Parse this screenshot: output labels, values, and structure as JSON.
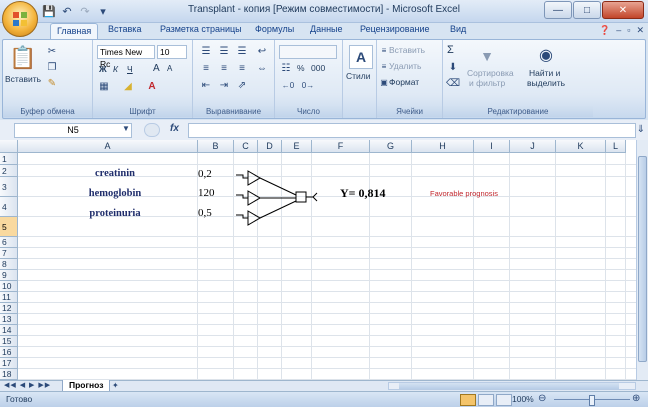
{
  "window": {
    "title": "Transplant - копия  [Режим совместимости] - Microsoft Excel"
  },
  "tabs": [
    "Главная",
    "Вставка",
    "Разметка страницы",
    "Формулы",
    "Данные",
    "Рецензирование",
    "Вид"
  ],
  "ribbon": {
    "clipboard": {
      "paste": "Вставить",
      "label": "Буфер обмена"
    },
    "font": {
      "name": "Times New Rc",
      "size": "10",
      "label": "Шрифт",
      "bold": "Ж",
      "italic": "К",
      "underline": "Ч",
      "grow": "A",
      "shrink": "A"
    },
    "alignment": {
      "label": "Выравнивание"
    },
    "number": {
      "label": "Число",
      "percent": "%",
      "thousands": "000"
    },
    "styles": {
      "label": "Стили"
    },
    "cells": {
      "insert": "Вставить",
      "delete": "Удалить",
      "format": "Формат",
      "label": "Ячейки"
    },
    "editing": {
      "sigma": "Σ",
      "sort_line1": "Сортировка",
      "sort_line2": "и фильтр",
      "find_line1": "Найти и",
      "find_line2": "выделить",
      "label": "Редактирование"
    }
  },
  "formula_bar": {
    "name_box": "N5",
    "fx": "fx"
  },
  "sheet": {
    "columns": [
      "A",
      "B",
      "C",
      "D",
      "E",
      "F",
      "G",
      "H",
      "I",
      "J",
      "K",
      "L"
    ],
    "rows": [
      "1",
      "2",
      "3",
      "4",
      "5",
      "6",
      "7",
      "8",
      "9",
      "10",
      "11",
      "12",
      "13",
      "14",
      "15",
      "16",
      "17",
      "18"
    ],
    "selected_row": "5",
    "inputs": [
      {
        "label": "creatinin",
        "value": "0,2"
      },
      {
        "label": "hemoglobin",
        "value": "120"
      },
      {
        "label": "proteinuria",
        "value": "0,5"
      }
    ],
    "result": {
      "text": "Y= 0,814",
      "prognosis": "Favorable prognosis"
    },
    "colors": {
      "label": "#1f2d6b",
      "prognosis": "#c0272d",
      "selected_row": "#f9d99f"
    }
  },
  "sheet_tab": {
    "name": "Прогноз"
  },
  "status": {
    "ready": "Готово",
    "zoom": "100%"
  }
}
